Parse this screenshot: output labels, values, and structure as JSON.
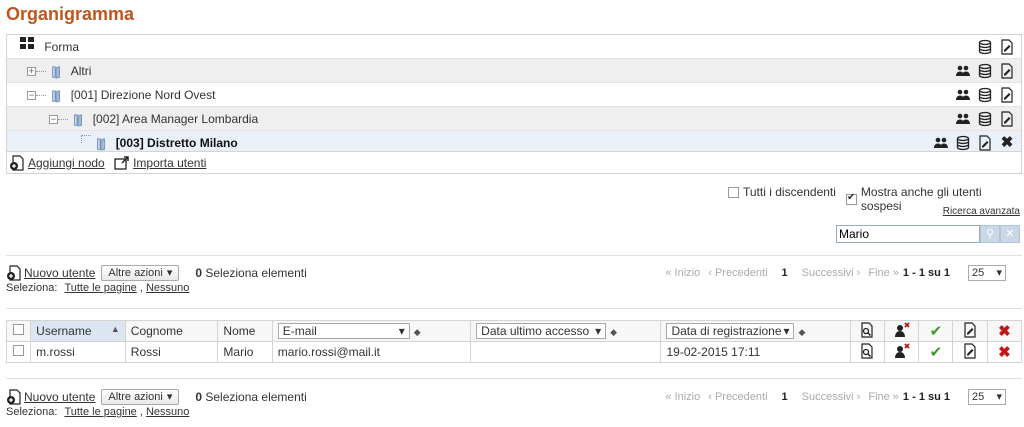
{
  "page_title": "Organigramma",
  "tree": {
    "rows": [
      {
        "label": "Forma",
        "level": 0
      },
      {
        "label": "Altri",
        "level": 1
      },
      {
        "label": "[001] Direzione Nord Ovest",
        "level": 1
      },
      {
        "label": "[002] Area Manager Lombardia",
        "level": 2
      },
      {
        "label": "[003] Distretto Milano",
        "level": 3
      }
    ],
    "add_node": "Aggiungi nodo",
    "import_users": "Importa utenti"
  },
  "options": {
    "all_descendants": "Tutti i discendenti",
    "show_suspended": "Mostra anche gli utenti sospesi",
    "advanced_search": "Ricerca avanzata"
  },
  "search": {
    "value": "Mario"
  },
  "actions": {
    "new_user": "Nuovo utente",
    "other_actions": "Altre azioni",
    "selected_count": "0",
    "selected_label": "Seleziona elementi",
    "select_prefix": "Seleziona:",
    "all_pages": "Tutte le pagine",
    "none": "Nessuno"
  },
  "pager": {
    "first": "« Inizio",
    "prev": "‹ Precedenti",
    "current": "1",
    "next": "Successivi ›",
    "last": "Fine »",
    "range": "1 - 1 su 1",
    "per_page": "25"
  },
  "table": {
    "headers": {
      "username": "Username",
      "surname": "Cognome",
      "name": "Nome",
      "email": "E-mail",
      "last_access": "Data ultimo accesso",
      "registration": "Data di registrazione"
    },
    "rows": [
      {
        "username": "m.rossi",
        "surname": "Rossi",
        "name": "Mario",
        "email": "mario.rossi@mail.it",
        "last_access": "",
        "registration": "19-02-2015 17:11"
      }
    ]
  },
  "colors": {
    "title": "#c0561d",
    "green": "#3a9a2e",
    "red": "#c01818"
  }
}
